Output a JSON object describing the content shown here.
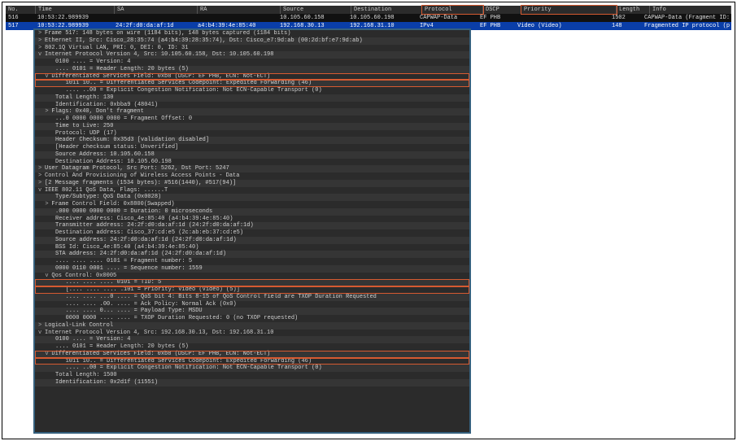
{
  "columns": {
    "no": "No.",
    "time": "Time",
    "sa": "SA",
    "ra": "RA",
    "src": "Source",
    "dst": "Destination",
    "proto": "Protocol",
    "dscp": "DSCP",
    "prio": "Priority",
    "len": "Length",
    "info": "Info"
  },
  "rows": [
    {
      "no": "516",
      "time": "10:53:22.989939",
      "sa": "",
      "ra": "",
      "src": "10.105.60.158",
      "dst": "10.105.60.198",
      "proto": "CAPWAP-Data",
      "dscp": "EF PHB",
      "prio": "",
      "len": "1502",
      "info": "CAPWAP-Data (Fragment ID:"
    },
    {
      "no": "517",
      "time": "10:53:22.989939",
      "sa": "24:2f:d0:da:af:1d",
      "ra": "a4:b4:39:4e:85:40",
      "src": "192.168.30.13",
      "dst": "192.168.31.10",
      "proto": "IPv4",
      "dscp": "EF PHB",
      "prio": "Video (Video)",
      "len": "148",
      "info": "Fragmented IP protocol (p"
    }
  ],
  "d": {
    "l1": "Frame 517: 148 bytes on wire (1184 bits), 148 bytes captured (1184 bits)",
    "l2": "Ethernet II, Src: Cisco_28:35:74 (a4:b4:39:28:35:74), Dst: Cisco_e7:9d:ab (00:2d:bf:e7:9d:ab)",
    "l3": "802.1Q Virtual LAN, PRI: 0, DEI: 0, ID: 31",
    "l4": "Internet Protocol Version 4, Src: 10.105.60.158, Dst: 10.105.60.198",
    "l5": "0100 .... = Version: 4",
    "l6": ".... 0101 = Header Length: 20 bytes (5)",
    "l7": "Differentiated Services Field: 0xb8 (DSCP: EF PHB, ECN: Not-ECT)",
    "l8": "1011 10.. = Differentiated Services Codepoint: Expedited Forwarding (46)",
    "l9": ".... ..00 = Explicit Congestion Notification: Not ECN-Capable Transport (0)",
    "l10": "Total Length: 130",
    "l11": "Identification: 0xbba9 (48041)",
    "l12": "Flags: 0x40, Don't fragment",
    "l13": "...0 0000 0000 0000 = Fragment Offset: 0",
    "l14": "Time to Live: 250",
    "l15": "Protocol: UDP (17)",
    "l16": "Header Checksum: 0x35d3 [validation disabled]",
    "l17": "[Header checksum status: Unverified]",
    "l18": "Source Address: 10.105.60.158",
    "l19": "Destination Address: 10.105.60.198",
    "l20": "User Datagram Protocol, Src Port: 5262, Dst Port: 5247",
    "l21": "Control And Provisioning of Wireless Access Points - Data",
    "l22": "[2 Message fragments (1534 bytes): #516(1440), #517(94)]",
    "l23": "IEEE 802.11 QoS Data, Flags: ......T",
    "l24": "Type/Subtype: QoS Data (0x0028)",
    "l25": "Frame Control Field: 0x8800(Swapped)",
    "l26": ".000 0000 0000 0000 = Duration: 0 microseconds",
    "l27": "Receiver address: Cisco_4e:85:40 (a4:b4:39:4e:85:40)",
    "l28": "Transmitter address: 24:2f:d0:da:af:1d (24:2f:d0:da:af:1d)",
    "l29": "Destination address: Cisco_37:cd:e5 (2c:ab:eb:37:cd:e5)",
    "l30": "Source address: 24:2f:d0:da:af:1d (24:2f:d0:da:af:1d)",
    "l31": "BSS Id: Cisco_4e:85:40 (a4:b4:39:4e:85:40)",
    "l32": "STA address: 24:2f:d0:da:af:1d (24:2f:d0:da:af:1d)",
    "l33": ".... .... .... 0101 = Fragment number: 5",
    "l34": "0000 0110 0001 .... = Sequence number: 1559",
    "l35": "Qos Control: 0x0005",
    "l36": ".... .... .... 0101 = TID: 5",
    "l37": "[.... .... .... .101 = Priority: Video (Video) (5)]",
    "l38": ".... .... ...0 .... = QoS bit 4: Bits 8-15 of QoS Control field are TXOP Duration Requested",
    "l39": ".... .... .00. .... = Ack Policy: Normal Ack (0x0)",
    "l40": ".... .... 0... .... = Payload Type: MSDU",
    "l41": "0000 0000 .... .... = TXOP Duration Requested: 0 (no TXOP requested)",
    "l42": "Logical-Link Control",
    "l43": "Internet Protocol Version 4, Src: 192.168.30.13, Dst: 192.168.31.10",
    "l44": "0100 .... = Version: 4",
    "l45": ".... 0101 = Header Length: 20 bytes (5)",
    "l46": "Differentiated Services Field: 0xb8 (DSCP: EF PHB, ECN: Not-ECT)",
    "l47": "1011 10.. = Differentiated Services Codepoint: Expedited Forwarding (46)",
    "l48": ".... ..00 = Explicit Congestion Notification: Not ECN-Capable Transport (0)",
    "l49": "Total Length: 1500",
    "l50": "Identification: 0x2d1f (11551)"
  }
}
